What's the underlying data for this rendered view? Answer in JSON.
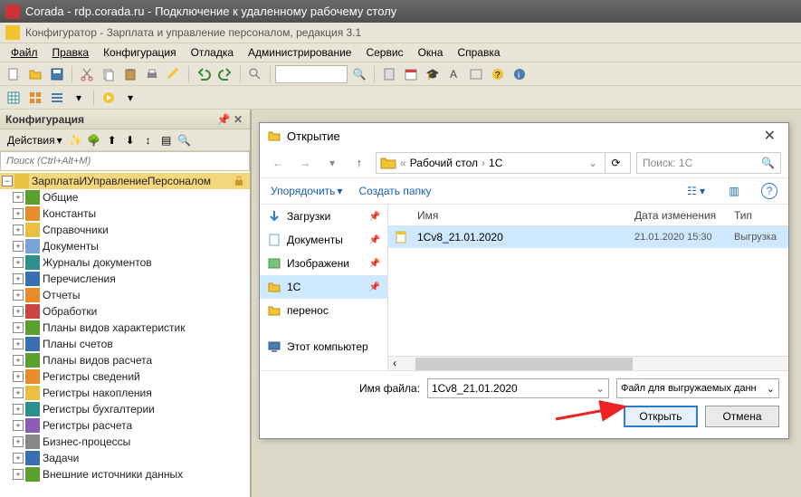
{
  "titlebar": "Corada - rdp.corada.ru - Подключение к удаленному рабочему столу",
  "app_header": "Конфигуратор - Зарплата и управление персоналом, редакция 3.1",
  "menu": [
    "Файл",
    "Правка",
    "Конфигурация",
    "Отладка",
    "Администрирование",
    "Сервис",
    "Окна",
    "Справка"
  ],
  "left_panel": {
    "title": "Конфигурация",
    "actions_label": "Действия",
    "search_placeholder": "Поиск (Ctrl+Alt+M)",
    "root": "ЗарплатаИУправлениеПерсоналом",
    "items": [
      {
        "label": "Общие",
        "icon": "ic-green"
      },
      {
        "label": "Константы",
        "icon": "ic-orange"
      },
      {
        "label": "Справочники",
        "icon": "ic-yellow"
      },
      {
        "label": "Документы",
        "icon": "ic-doc"
      },
      {
        "label": "Журналы документов",
        "icon": "ic-teal"
      },
      {
        "label": "Перечисления",
        "icon": "ic-blue"
      },
      {
        "label": "Отчеты",
        "icon": "ic-orange"
      },
      {
        "label": "Обработки",
        "icon": "ic-red"
      },
      {
        "label": "Планы видов характеристик",
        "icon": "ic-green"
      },
      {
        "label": "Планы счетов",
        "icon": "ic-blue"
      },
      {
        "label": "Планы видов расчета",
        "icon": "ic-green"
      },
      {
        "label": "Регистры сведений",
        "icon": "ic-orange"
      },
      {
        "label": "Регистры накопления",
        "icon": "ic-yellow"
      },
      {
        "label": "Регистры бухгалтерии",
        "icon": "ic-teal"
      },
      {
        "label": "Регистры расчета",
        "icon": "ic-purple"
      },
      {
        "label": "Бизнес-процессы",
        "icon": "ic-gray"
      },
      {
        "label": "Задачи",
        "icon": "ic-blue"
      },
      {
        "label": "Внешние источники данных",
        "icon": "ic-green"
      }
    ]
  },
  "dialog": {
    "title": "Открытие",
    "path_prefix": "«",
    "path_seg1": "Рабочий стол",
    "path_seg2": "1С",
    "search_placeholder": "Поиск: 1С",
    "organize": "Упорядочить",
    "new_folder": "Создать папку",
    "sidebar": [
      {
        "label": "Загрузки",
        "icon": "down",
        "pin": true
      },
      {
        "label": "Документы",
        "icon": "doc",
        "pin": true
      },
      {
        "label": "Изображени",
        "icon": "img",
        "pin": true
      },
      {
        "label": "1С",
        "icon": "fld",
        "pin": true,
        "sel": true
      },
      {
        "label": "перенос",
        "icon": "fld",
        "pin": false
      },
      {
        "label": "Этот компьютер",
        "icon": "pc",
        "pin": false,
        "spacer": true
      }
    ],
    "columns": {
      "name": "Имя",
      "date": "Дата изменения",
      "type": "Тип"
    },
    "files": [
      {
        "name": "1Cv8_21.01.2020",
        "date": "21.01.2020 15:30",
        "type": "Выгрузка",
        "sel": true
      }
    ],
    "filename_label": "Имя файла:",
    "filename_value": "1Cv8_21.01.2020",
    "filter": "Файл для выгружаемых данн",
    "open": "Открыть",
    "cancel": "Отмена"
  }
}
